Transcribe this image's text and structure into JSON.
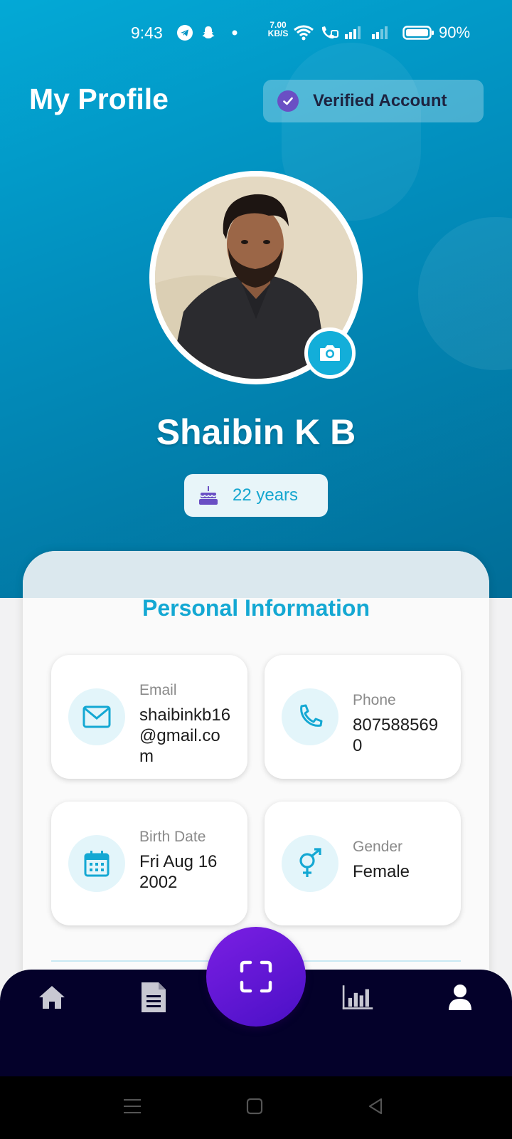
{
  "status_bar": {
    "time": "9:43",
    "net_speed_value": "7.00",
    "net_speed_unit": "KB/S",
    "battery": "90%",
    "icons": [
      "telegram-icon",
      "snapchat-icon",
      "dot-icon",
      "wifi-icon",
      "volte-call-icon",
      "signal-icon",
      "signal-icon",
      "battery-icon"
    ]
  },
  "header": {
    "title": "My Profile",
    "verified_label": "Verified Account"
  },
  "profile": {
    "name": "Shaibin K B",
    "age": "22 years"
  },
  "personal_info": {
    "title": "Personal Information",
    "email": {
      "label": "Email",
      "value": "shaibinkb16@gmail.com"
    },
    "phone": {
      "label": "Phone",
      "value": "8075885690"
    },
    "birth_date": {
      "label": "Birth Date",
      "value": "Fri Aug 16 2002"
    },
    "gender": {
      "label": "Gender",
      "value": "Female"
    }
  },
  "bottom_nav": {
    "items": [
      "home-icon",
      "document-icon",
      "scan-icon",
      "chart-icon",
      "user-icon"
    ],
    "active": "user-icon"
  },
  "colors": {
    "hero_top": "#03a9d6",
    "hero_bottom": "#016d97",
    "accent": "#14a8d3",
    "verified_check": "#6a4fc4",
    "nav_bg": "#04012a",
    "scan_btn": "#7b1fe3"
  }
}
